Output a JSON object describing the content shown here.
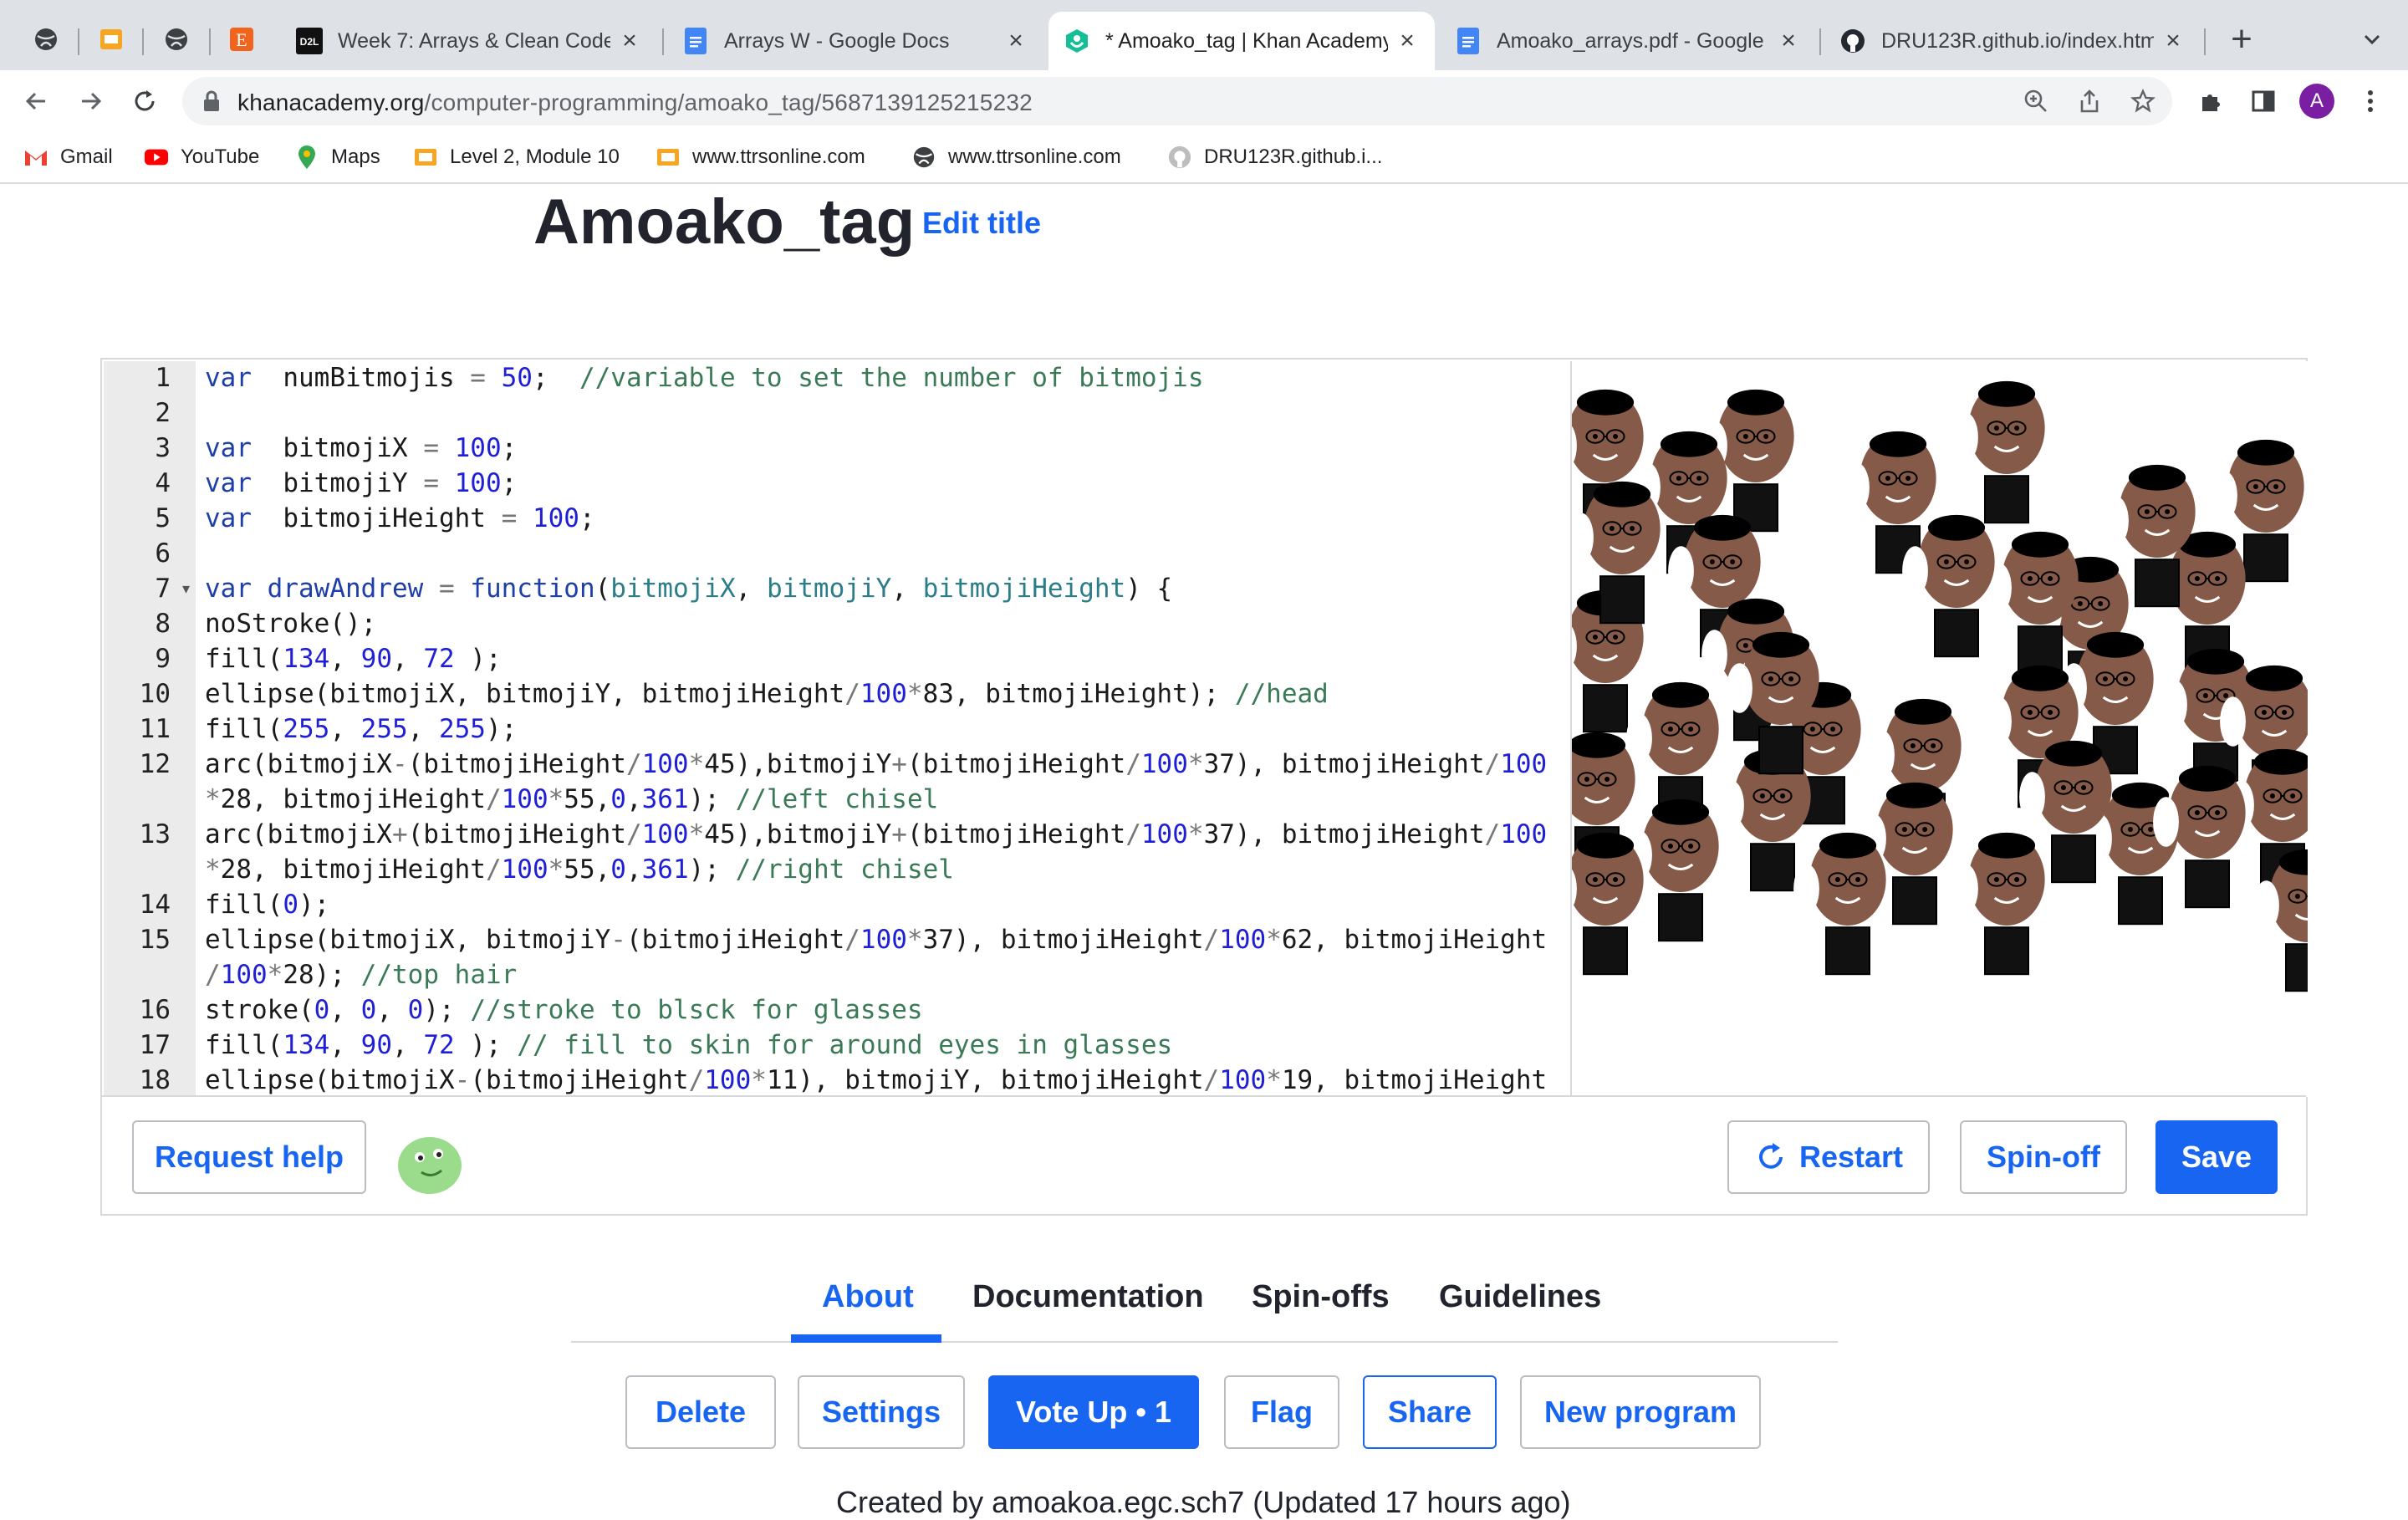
{
  "browser": {
    "tabs": [
      {
        "title": "Week 7: Arrays & Clean Code",
        "icon": "d2l-icon",
        "active": false
      },
      {
        "title": "Arrays W - Google Docs",
        "icon": "google-docs-icon",
        "active": false
      },
      {
        "title": "* Amoako_tag | Khan Academy",
        "icon": "khan-academy-icon",
        "active": true
      },
      {
        "title": "Amoako_arrays.pdf - Google",
        "icon": "google-docs-icon",
        "active": false
      },
      {
        "title": "DRU123R.github.io/index.htm",
        "icon": "github-icon",
        "active": false
      }
    ],
    "url_host": "khanacademy.org",
    "url_path": "/computer-programming/amoako_tag/5687139125215232",
    "profile_initial": "A",
    "bookmarks": [
      "Gmail",
      "YouTube",
      "Maps",
      "Level 2, Module 10",
      "www.ttrsonline.com",
      "www.ttrsonline.com",
      "DRU123R.github.i..."
    ]
  },
  "page": {
    "title": "Amoako_tag",
    "edit_title": "Edit title"
  },
  "editor": {
    "line_numbers": [
      "1",
      "2",
      "3",
      "4",
      "5",
      "6",
      "7",
      "8",
      "9",
      "10",
      "11",
      "12",
      "",
      "13",
      "",
      "14",
      "15",
      "",
      "16",
      "17",
      "18"
    ],
    "lines": [
      [
        [
          "kw",
          "var"
        ],
        [
          "",
          "  numBitmojis "
        ],
        [
          "op",
          "="
        ],
        [
          "num",
          " 50"
        ],
        [
          "",
          ";  "
        ],
        [
          "com",
          "//variable to set the number of bitmojis"
        ]
      ],
      [],
      [
        [
          "kw",
          "var"
        ],
        [
          "",
          "  bitmojiX "
        ],
        [
          "op",
          "="
        ],
        [
          "num",
          " 100"
        ],
        [
          "",
          ";"
        ]
      ],
      [
        [
          "kw",
          "var"
        ],
        [
          "",
          "  bitmojiY "
        ],
        [
          "op",
          "="
        ],
        [
          "num",
          " 100"
        ],
        [
          "",
          ";"
        ]
      ],
      [
        [
          "kw",
          "var"
        ],
        [
          "",
          "  bitmojiHeight "
        ],
        [
          "op",
          "="
        ],
        [
          "num",
          " 100"
        ],
        [
          "",
          ";"
        ]
      ],
      [],
      [
        [
          "kw",
          "var"
        ],
        [
          "",
          " "
        ],
        [
          "kw",
          "drawAndrew"
        ],
        [
          "op",
          " ="
        ],
        [
          "kw",
          " function"
        ],
        [
          "",
          "("
        ],
        [
          "par",
          "bitmojiX"
        ],
        [
          "",
          ", "
        ],
        [
          "par",
          "bitmojiY"
        ],
        [
          "",
          ", "
        ],
        [
          "par",
          "bitmojiHeight"
        ],
        [
          "",
          ") {"
        ]
      ],
      [
        [
          "",
          "noStroke();"
        ]
      ],
      [
        [
          "",
          "fill("
        ],
        [
          "num",
          "134"
        ],
        [
          "",
          ", "
        ],
        [
          "num",
          "90"
        ],
        [
          "",
          ", "
        ],
        [
          "num",
          "72"
        ],
        [
          "",
          " );"
        ]
      ],
      [
        [
          "",
          "ellipse(bitmojiX, bitmojiY, bitmojiHeight"
        ],
        [
          "op",
          "/"
        ],
        [
          "num",
          "100"
        ],
        [
          "op",
          "*"
        ],
        [
          "",
          "83, bitmojiHeight); "
        ],
        [
          "com",
          "//head"
        ]
      ],
      [
        [
          "",
          "fill("
        ],
        [
          "num",
          "255"
        ],
        [
          "",
          ", "
        ],
        [
          "num",
          "255"
        ],
        [
          "",
          ", "
        ],
        [
          "num",
          "255"
        ],
        [
          "",
          ");"
        ]
      ],
      [
        [
          "",
          "arc(bitmojiX"
        ],
        [
          "op",
          "-"
        ],
        [
          "",
          "(bitmojiHeight"
        ],
        [
          "op",
          "/"
        ],
        [
          "num",
          "100"
        ],
        [
          "op",
          "*"
        ],
        [
          "",
          "45),bitmojiY"
        ],
        [
          "op",
          "+"
        ],
        [
          "",
          "(bitmojiHeight"
        ],
        [
          "op",
          "/"
        ],
        [
          "num",
          "100"
        ],
        [
          "op",
          "*"
        ],
        [
          "",
          "37), bitmojiHeight"
        ],
        [
          "op",
          "/"
        ],
        [
          "num",
          "100"
        ]
      ],
      [
        [
          "op",
          "*"
        ],
        [
          "",
          "28, bitmojiHeight"
        ],
        [
          "op",
          "/"
        ],
        [
          "num",
          "100"
        ],
        [
          "op",
          "*"
        ],
        [
          "",
          "55,"
        ],
        [
          "num",
          "0"
        ],
        [
          "",
          ","
        ],
        [
          "num",
          "361"
        ],
        [
          "",
          "); "
        ],
        [
          "com",
          "//left chisel"
        ]
      ],
      [
        [
          "",
          "arc(bitmojiX"
        ],
        [
          "op",
          "+"
        ],
        [
          "",
          "(bitmojiHeight"
        ],
        [
          "op",
          "/"
        ],
        [
          "num",
          "100"
        ],
        [
          "op",
          "*"
        ],
        [
          "",
          "45),bitmojiY"
        ],
        [
          "op",
          "+"
        ],
        [
          "",
          "(bitmojiHeight"
        ],
        [
          "op",
          "/"
        ],
        [
          "num",
          "100"
        ],
        [
          "op",
          "*"
        ],
        [
          "",
          "37), bitmojiHeight"
        ],
        [
          "op",
          "/"
        ],
        [
          "num",
          "100"
        ]
      ],
      [
        [
          "op",
          "*"
        ],
        [
          "",
          "28, bitmojiHeight"
        ],
        [
          "op",
          "/"
        ],
        [
          "num",
          "100"
        ],
        [
          "op",
          "*"
        ],
        [
          "",
          "55,"
        ],
        [
          "num",
          "0"
        ],
        [
          "",
          ","
        ],
        [
          "num",
          "361"
        ],
        [
          "",
          "); "
        ],
        [
          "com",
          "//right chisel"
        ]
      ],
      [
        [
          "",
          "fill("
        ],
        [
          "num",
          "0"
        ],
        [
          "",
          ");"
        ]
      ],
      [
        [
          "",
          "ellipse(bitmojiX, bitmojiY"
        ],
        [
          "op",
          "-"
        ],
        [
          "",
          "(bitmojiHeight"
        ],
        [
          "op",
          "/"
        ],
        [
          "num",
          "100"
        ],
        [
          "op",
          "*"
        ],
        [
          "",
          "37), bitmojiHeight"
        ],
        [
          "op",
          "/"
        ],
        [
          "num",
          "100"
        ],
        [
          "op",
          "*"
        ],
        [
          "",
          "62, bitmojiHeight"
        ]
      ],
      [
        [
          "op",
          "/"
        ],
        [
          "num",
          "100"
        ],
        [
          "op",
          "*"
        ],
        [
          "",
          "28); "
        ],
        [
          "com",
          "//top hair"
        ]
      ],
      [
        [
          "",
          "stroke("
        ],
        [
          "num",
          "0"
        ],
        [
          "",
          ", "
        ],
        [
          "num",
          "0"
        ],
        [
          "",
          ", "
        ],
        [
          "num",
          "0"
        ],
        [
          "",
          "); "
        ],
        [
          "com",
          "//stroke to blsck for glasses"
        ]
      ],
      [
        [
          "",
          "fill("
        ],
        [
          "num",
          "134"
        ],
        [
          "",
          ", "
        ],
        [
          "num",
          "90"
        ],
        [
          "",
          ", "
        ],
        [
          "num",
          "72"
        ],
        [
          "",
          " ); "
        ],
        [
          "com",
          "// fill to skin for around eyes in glasses"
        ]
      ],
      [
        [
          "",
          "ellipse(bitmojiX"
        ],
        [
          "op",
          "-"
        ],
        [
          "",
          "(bitmojiHeight"
        ],
        [
          "op",
          "/"
        ],
        [
          "num",
          "100"
        ],
        [
          "op",
          "*"
        ],
        [
          "",
          "11), bitmojiY, bitmojiHeight"
        ],
        [
          "op",
          "/"
        ],
        [
          "num",
          "100"
        ],
        [
          "op",
          "*"
        ],
        [
          "",
          "19, bitmojiHeight"
        ]
      ]
    ]
  },
  "controls": {
    "request_help": "Request help",
    "restart": "Restart",
    "spin_off": "Spin-off",
    "save": "Save"
  },
  "info_tabs": [
    "About",
    "Documentation",
    "Spin-offs",
    "Guidelines"
  ],
  "actions": {
    "delete": "Delete",
    "settings": "Settings",
    "vote_up": "Vote Up • 1",
    "flag": "Flag",
    "share": "Share",
    "new_program": "New program"
  },
  "footer_text": "Created by amoakoa.egc.sch7 (Updated 17 hours ago)",
  "colors": {
    "accent": "#1865f2",
    "skin": "#865a48",
    "chrome_bg": "#dee1e6"
  }
}
